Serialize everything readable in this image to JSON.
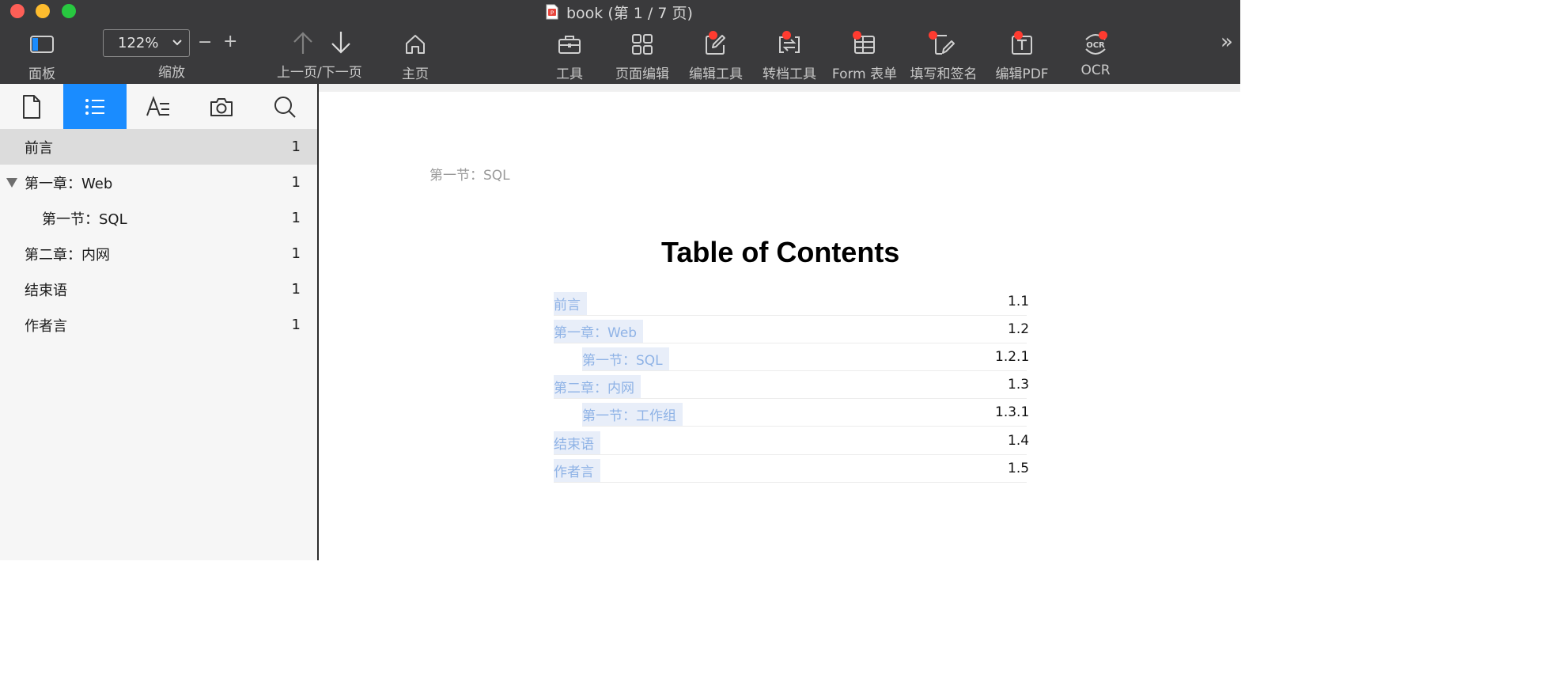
{
  "window": {
    "title": "book (第 1 / 7 页)"
  },
  "toolbar": {
    "panel_label": "面板",
    "zoom_value": "122%",
    "zoom_label": "缩放",
    "zoom_minus": "−",
    "zoom_plus": "+",
    "prevnext_label": "上一页/下一页",
    "home_label": "主页",
    "tools_label": "工具",
    "page_edit_label": "页面编辑",
    "edit_tools_label": "编辑工具",
    "convert_label": "转档工具",
    "form_label": "Form 表单",
    "fill_sign_label": "填写和签名",
    "edit_pdf_label": "编辑PDF",
    "ocr_label": "OCR",
    "ocr_icon_text": "OCR",
    "more_label": "»"
  },
  "sidebar": {
    "tabs": [
      "page-thumbnails",
      "outline",
      "annotations",
      "snapshots",
      "search"
    ],
    "active_tab": "outline",
    "outline": [
      {
        "label": "前言",
        "page": "1",
        "selected": true
      },
      {
        "label": "第一章：Web",
        "page": "1",
        "expanded": true
      },
      {
        "label": "第一节：SQL",
        "page": "1",
        "level": 2
      },
      {
        "label": "第二章：内网",
        "page": "1"
      },
      {
        "label": "结束语",
        "page": "1"
      },
      {
        "label": "作者言",
        "page": "1"
      }
    ]
  },
  "document": {
    "running_header": "第一节：SQL",
    "toc_title": "Table of Contents",
    "toc": [
      {
        "title": "前言",
        "num": "1.1"
      },
      {
        "title": "第一章：Web",
        "num": "1.2"
      },
      {
        "title": "第一节：SQL",
        "num": "1.2.1"
      },
      {
        "title": "第二章：内网",
        "num": "1.3"
      },
      {
        "title": "第一节：工作组",
        "num": "1.3.1"
      },
      {
        "title": "结束语",
        "num": "1.4"
      },
      {
        "title": "作者言",
        "num": "1.5"
      }
    ]
  },
  "colors": {
    "accent": "#1a8cff",
    "toolbar_bg": "#3a3a3c",
    "badge": "#ff3b30",
    "link": "#8fb3e6"
  }
}
